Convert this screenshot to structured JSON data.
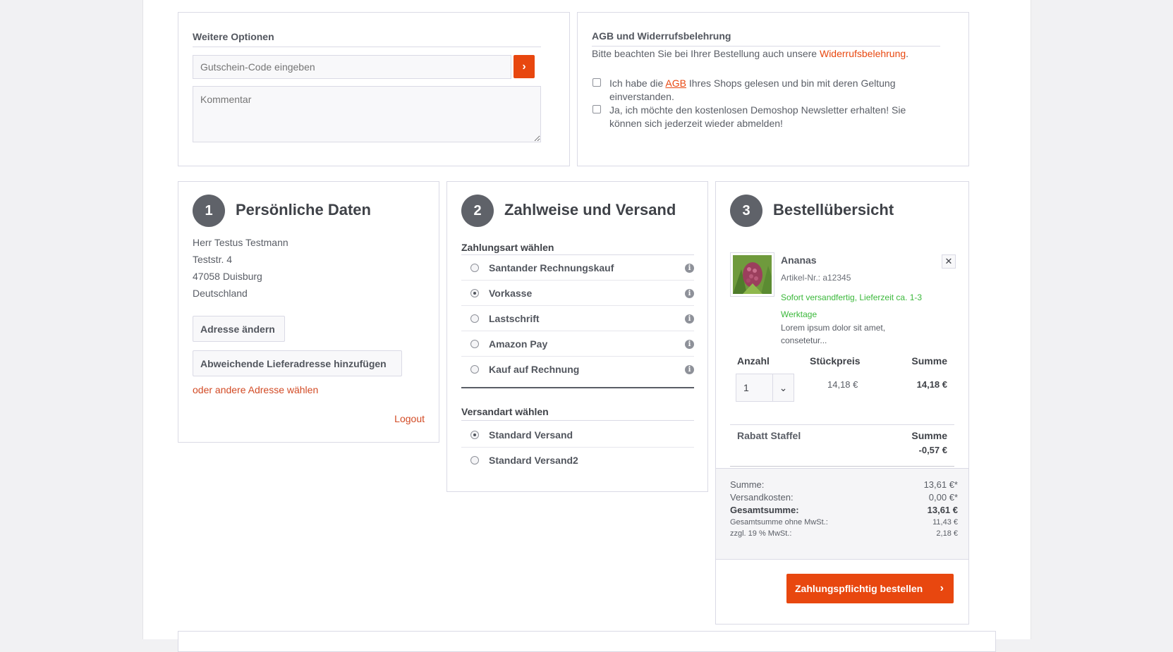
{
  "options": {
    "title": "Weitere Optionen",
    "voucher_placeholder": "Gutschein-Code eingeben",
    "comment_placeholder": "Kommentar"
  },
  "terms": {
    "title": "AGB und Widerrufsbelehrung",
    "intro_before": "Bitte beachten Sie bei Ihrer Bestellung auch unsere ",
    "intro_link": "Widerrufsbelehrung",
    "intro_after": ".",
    "agb_before": "Ich habe die ",
    "agb_link": "AGB",
    "agb_after": " Ihres Shops gelesen und bin mit deren Geltung einverstanden.",
    "newsletter": "Ja, ich möchte den kostenlosen Demoshop Newsletter erhalten! Sie können sich jederzeit wieder abmelden!"
  },
  "personal": {
    "step": "1",
    "title": "Persönliche Daten",
    "address": [
      "Herr Testus Testmann",
      "Teststr. 4",
      "47058 Duisburg",
      "Deutschland"
    ],
    "change_address": "Adresse ändern",
    "add_shipping": "Abweichende Lieferadresse hinzufügen",
    "other_address": "oder andere Adresse wählen",
    "logout": "Logout"
  },
  "payment": {
    "step": "2",
    "title": "Zahlweise und Versand",
    "payment_label": "Zahlungsart wählen",
    "methods": [
      {
        "label": "Santander Rechnungskauf",
        "checked": false
      },
      {
        "label": "Vorkasse",
        "checked": true
      },
      {
        "label": "Lastschrift",
        "checked": false
      },
      {
        "label": "Amazon Pay",
        "checked": false
      },
      {
        "label": "Kauf auf Rechnung",
        "checked": false
      }
    ],
    "shipping_label": "Versandart wählen",
    "shipping": [
      {
        "label": "Standard Versand",
        "checked": true
      },
      {
        "label": "Standard Versand2",
        "checked": false
      }
    ]
  },
  "summary": {
    "step": "3",
    "title": "Bestellübersicht",
    "product_name": "Ananas",
    "article_no": "Artikel-Nr.: a12345",
    "delivery": "Sofort versandfertig, Lieferzeit ca. 1-3 Werktage",
    "description": "Lorem ipsum dolor sit amet, consetetur...",
    "col_quantity": "Anzahl",
    "col_unit_price": "Stückpreis",
    "col_sum": "Summe",
    "quantity": "1",
    "unit_price": "14,18 €",
    "line_sum": "14,18 €",
    "discount_label": "Rabatt Staffel",
    "discount_sum_label": "Summe",
    "discount_value": "-0,57 €",
    "totals": {
      "sum_label": "Summe:",
      "sum_value": "13,61 €*",
      "shipping_label": "Versandkosten:",
      "shipping_value": "0,00 €*",
      "total_label": "Gesamtsumme:",
      "total_value": "13,61 €",
      "net_label": "Gesamtsumme ohne MwSt.:",
      "net_value": "11,43 €",
      "vat_label": "zzgl. 19 % MwSt.:",
      "vat_value": "2,18 €"
    },
    "order_button": "Zahlungspflichtig bestellen"
  },
  "colors": {
    "accent": "#e8470f",
    "delivery_green": "#3bb83b",
    "step_circle": "#5f6269"
  }
}
